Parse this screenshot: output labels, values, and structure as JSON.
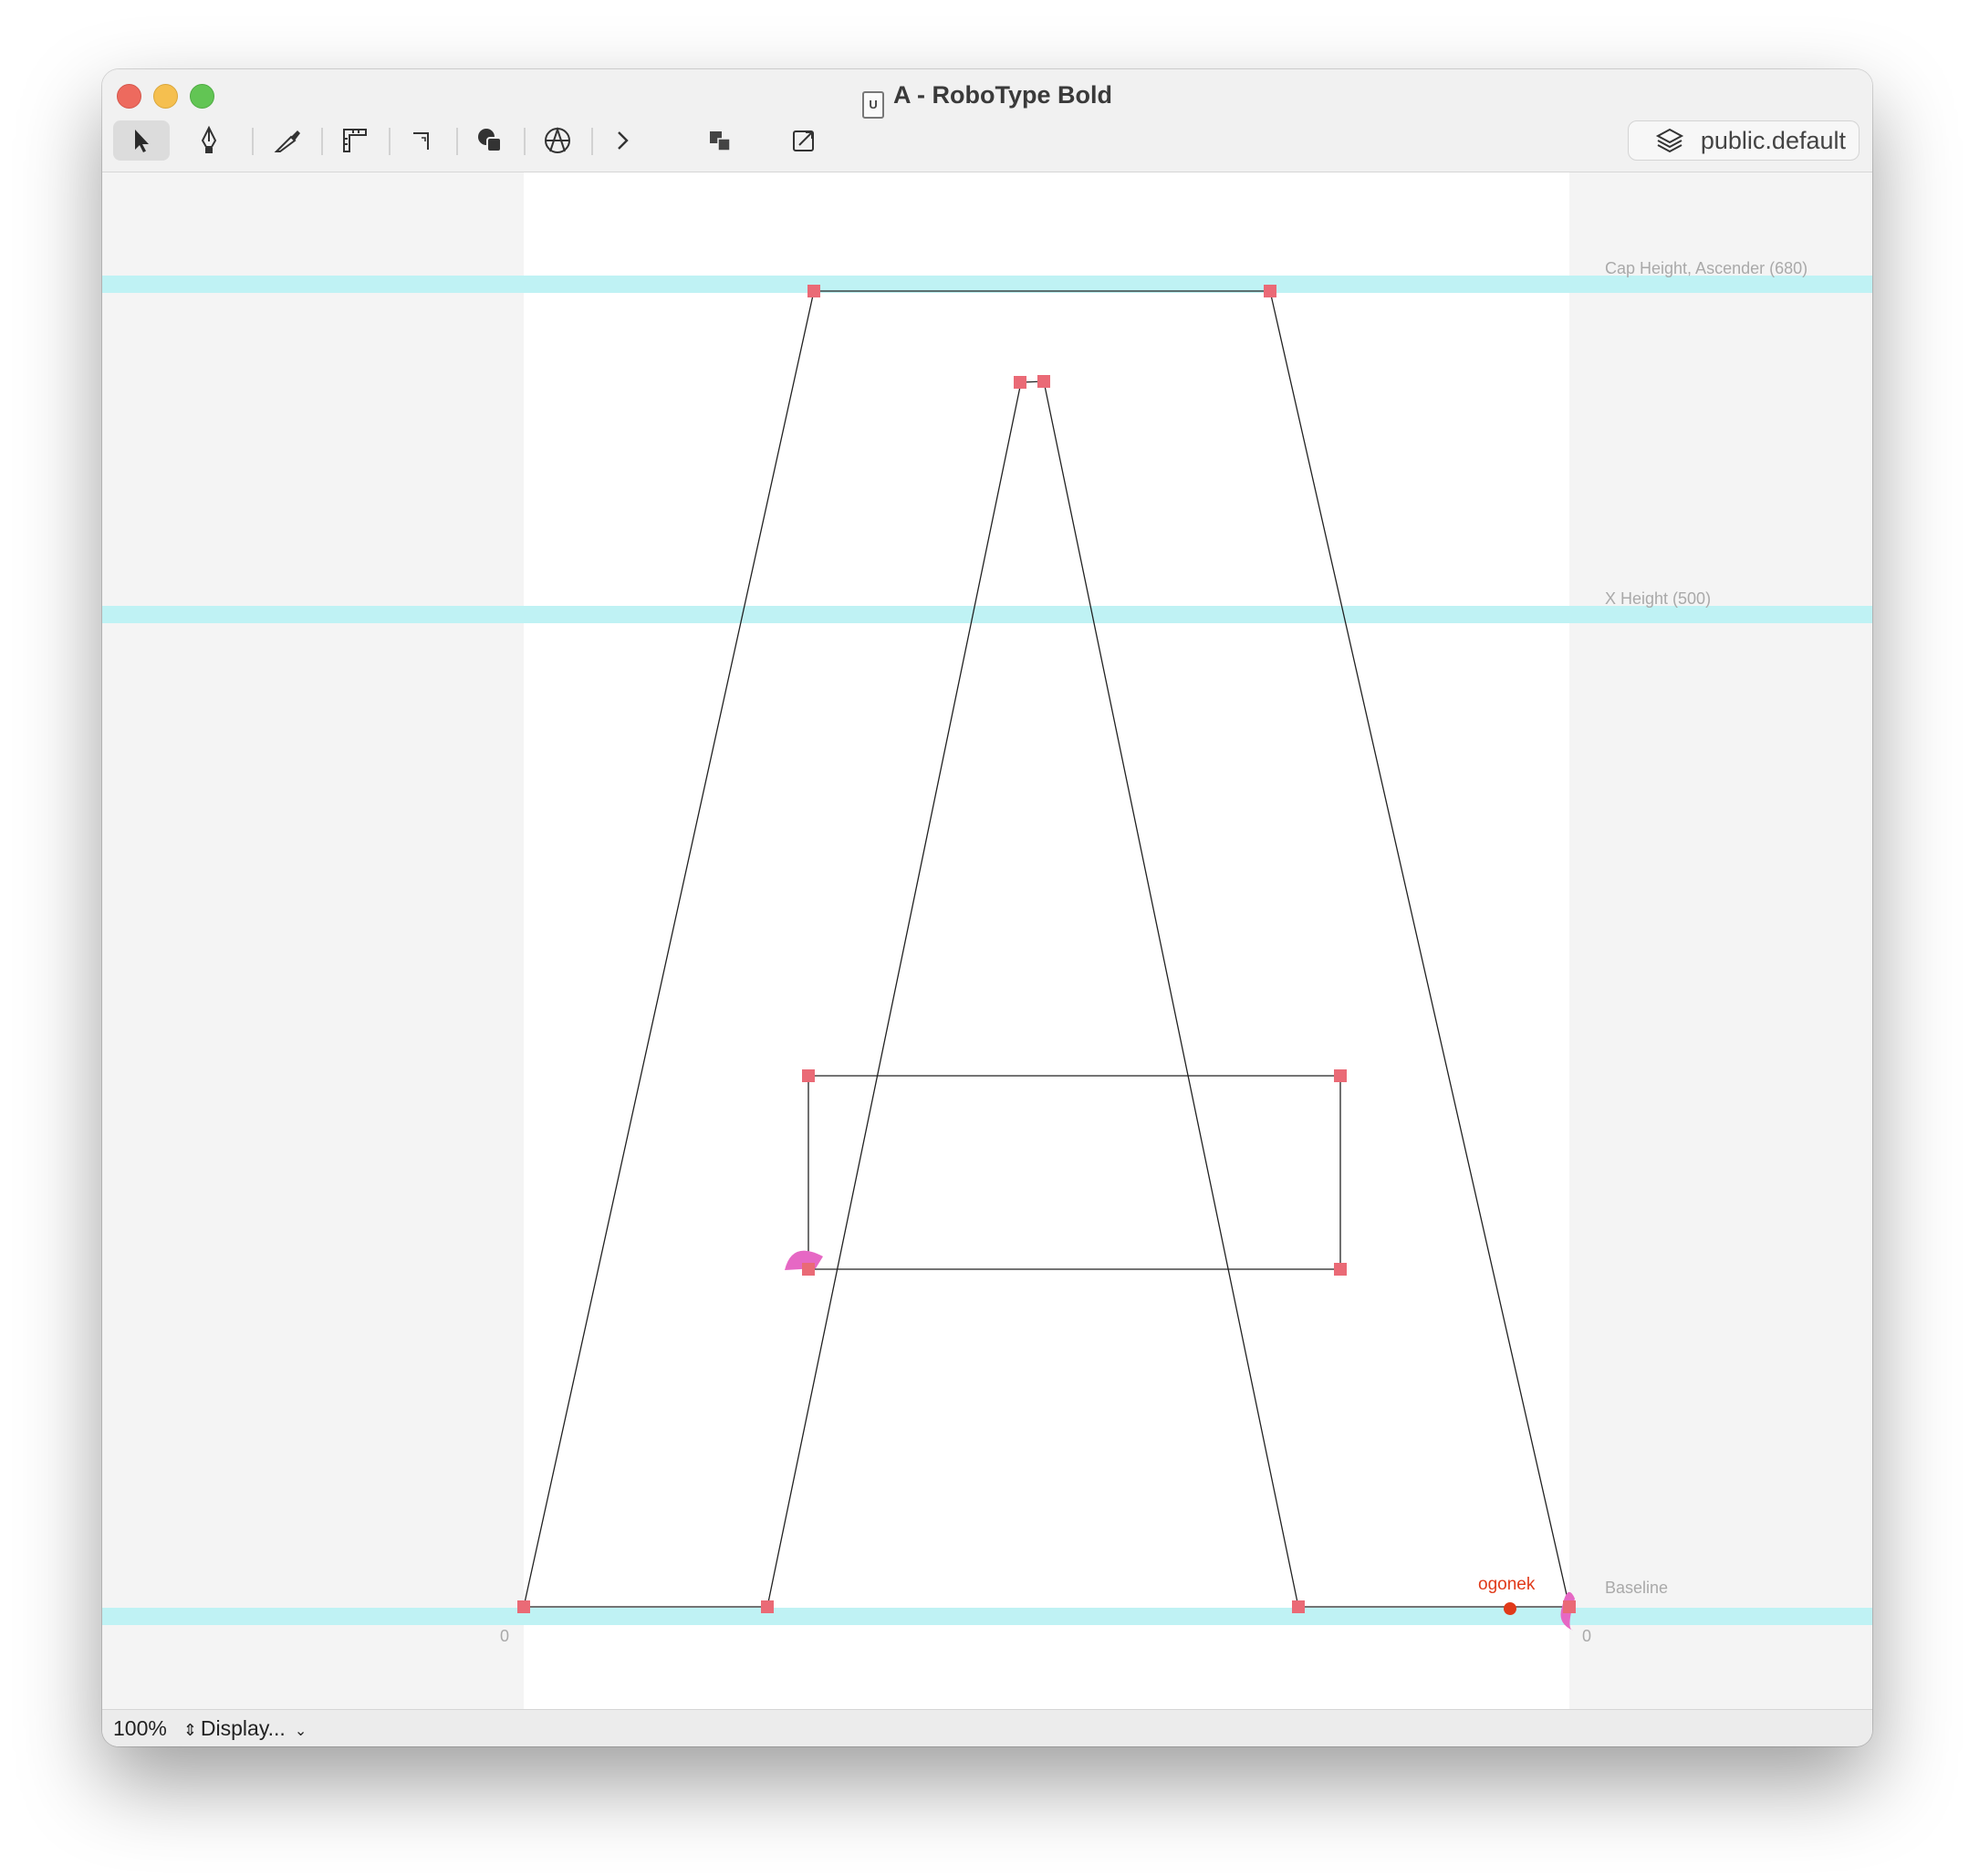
{
  "window": {
    "title": "A - RoboType Bold",
    "doc_icon": "ufo-file-icon",
    "doc_icon_text": "U"
  },
  "toolbar": {
    "tools": [
      {
        "name": "select-tool",
        "icon": "arrow-pointer-icon",
        "active": true
      },
      {
        "name": "pen-tool",
        "icon": "pen-nib-icon"
      },
      {
        "name": "knife-tool",
        "icon": "knife-icon"
      },
      {
        "name": "measure-tool",
        "icon": "ruler-icon"
      },
      {
        "name": "corner-tool",
        "icon": "corner-icon"
      },
      {
        "name": "shapes-tool",
        "icon": "shapes-icon"
      },
      {
        "name": "anchor-tool",
        "icon": "anchor-circle-icon"
      },
      {
        "name": "more-tools",
        "icon": "chevron-right-icon"
      }
    ],
    "extra_buttons": [
      {
        "name": "boolean-glyph-view",
        "icon": "overlap-squares-icon"
      },
      {
        "name": "transform-tool",
        "icon": "transform-icon"
      }
    ],
    "layer_label": "public.default",
    "layer_icon": "layers-icon"
  },
  "guides": {
    "cap_height": "Cap Height, Ascender (680)",
    "x_height": "X Height (500)",
    "baseline": "Baseline",
    "left_metric": "0",
    "right_metric": "0"
  },
  "anchor": {
    "name": "ogonek",
    "color": "#e03a1a"
  },
  "colors": {
    "guide": "#bff2f4",
    "point": "#ea6a76",
    "start_marker": "#e668c4"
  },
  "status": {
    "zoom": "100%",
    "display": "Display..."
  }
}
